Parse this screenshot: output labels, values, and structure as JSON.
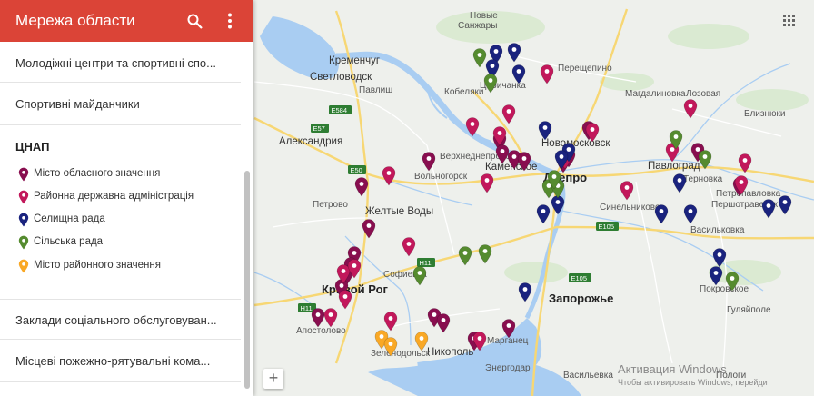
{
  "panel": {
    "title": "Мережа области",
    "layers_top": [
      "Молодіжні центри та спортивні спо...",
      "Спортивні майданчики"
    ],
    "section_title": "ЦНАП",
    "legend": [
      {
        "label": "Місто обласного значення",
        "color": "#880e4f"
      },
      {
        "label": "Районна державна адміністрація",
        "color": "#c2185b"
      },
      {
        "label": "Селищна рада",
        "color": "#1a237e"
      },
      {
        "label": "Сільська рада",
        "color": "#558b2f"
      },
      {
        "label": "Місто районного значення",
        "color": "#f9a825"
      }
    ],
    "layers_bottom": [
      "Заклади соціального обслуговуван...",
      "Місцеві пожежно-рятувальні кома..."
    ]
  },
  "map": {
    "places": [
      {
        "name": "Новые",
        "size": "small"
      },
      {
        "name": "Санжары",
        "size": "small"
      },
      {
        "name": "Кременчуг",
        "size": "mid"
      },
      {
        "name": "Светловодск",
        "size": "mid"
      },
      {
        "name": "Кобеляки",
        "size": "small"
      },
      {
        "name": "Павлиш",
        "size": "small"
      },
      {
        "name": "Царичанка",
        "size": "small"
      },
      {
        "name": "Магдалиновка",
        "size": "small"
      },
      {
        "name": "Перещепино",
        "size": "small"
      },
      {
        "name": "Лозовая",
        "size": "small"
      },
      {
        "name": "Близнюки",
        "size": "small"
      },
      {
        "name": "Александрия",
        "size": "mid"
      },
      {
        "name": "Верхнеднепровск",
        "size": "small"
      },
      {
        "name": "Новомосковск",
        "size": "mid"
      },
      {
        "name": "Каменское",
        "size": "mid"
      },
      {
        "name": "Днепро",
        "size": "big"
      },
      {
        "name": "Павлоград",
        "size": "mid"
      },
      {
        "name": "Терновка",
        "size": "small"
      },
      {
        "name": "Петропавловка",
        "size": "small"
      },
      {
        "name": "Першотравенск",
        "size": "small"
      },
      {
        "name": "Вольногорск",
        "size": "small"
      },
      {
        "name": "Желтые Воды",
        "size": "mid"
      },
      {
        "name": "Петрово",
        "size": "small"
      },
      {
        "name": "Синельниково",
        "size": "small"
      },
      {
        "name": "Васильковка",
        "size": "small"
      },
      {
        "name": "Софиевка",
        "size": "small"
      },
      {
        "name": "Кривой Рог",
        "size": "big"
      },
      {
        "name": "Запорожье",
        "size": "big"
      },
      {
        "name": "Покровское",
        "size": "small"
      },
      {
        "name": "Гуляйполе",
        "size": "small"
      },
      {
        "name": "Марганец",
        "size": "small"
      },
      {
        "name": "Никополь",
        "size": "mid"
      },
      {
        "name": "Энергодар",
        "size": "small"
      },
      {
        "name": "Васильевка",
        "size": "small"
      },
      {
        "name": "Пологи",
        "size": "small"
      },
      {
        "name": "Зеленодольск",
        "size": "small"
      },
      {
        "name": "Апостолово",
        "size": "small"
      }
    ],
    "highways": [
      "E584",
      "E57",
      "E50",
      "H11",
      "H11",
      "E105",
      "E105"
    ],
    "watermark": {
      "line1": "Активация Windows",
      "line2": "Чтобы активировать Windows, перейди"
    },
    "zoom_label": "+",
    "markers": [
      {
        "type": 0
      },
      {
        "type": 0
      },
      {
        "type": 0
      },
      {
        "type": 0
      },
      {
        "type": 0
      },
      {
        "type": 0
      },
      {
        "type": 0
      },
      {
        "type": 0
      },
      {
        "type": 0
      },
      {
        "type": 0
      },
      {
        "type": 0
      },
      {
        "type": 0
      },
      {
        "type": 0
      },
      {
        "type": 0
      },
      {
        "type": 0
      },
      {
        "type": 0
      },
      {
        "type": 0
      },
      {
        "type": 0
      },
      {
        "type": 0
      },
      {
        "type": 0
      },
      {
        "type": 0
      },
      {
        "type": 1
      },
      {
        "type": 1
      },
      {
        "type": 1
      },
      {
        "type": 1
      },
      {
        "type": 1
      },
      {
        "type": 1
      },
      {
        "type": 1
      },
      {
        "type": 1
      },
      {
        "type": 1
      },
      {
        "type": 1
      },
      {
        "type": 1
      },
      {
        "type": 1
      },
      {
        "type": 1
      },
      {
        "type": 1
      },
      {
        "type": 1
      },
      {
        "type": 1
      },
      {
        "type": 1
      },
      {
        "type": 1
      },
      {
        "type": 1
      },
      {
        "type": 1
      },
      {
        "type": 2
      },
      {
        "type": 2
      },
      {
        "type": 2
      },
      {
        "type": 2
      },
      {
        "type": 2
      },
      {
        "type": 2
      },
      {
        "type": 2
      },
      {
        "type": 2
      },
      {
        "type": 2
      },
      {
        "type": 2
      },
      {
        "type": 2
      },
      {
        "type": 2
      },
      {
        "type": 2
      },
      {
        "type": 2
      },
      {
        "type": 2
      },
      {
        "type": 2
      },
      {
        "type": 2
      },
      {
        "type": 3
      },
      {
        "type": 3
      },
      {
        "type": 3
      },
      {
        "type": 3
      },
      {
        "type": 3
      },
      {
        "type": 3
      },
      {
        "type": 3
      },
      {
        "type": 3
      },
      {
        "type": 3
      },
      {
        "type": 3
      },
      {
        "type": 3
      },
      {
        "type": 4
      },
      {
        "type": 4
      },
      {
        "type": 4
      }
    ]
  }
}
